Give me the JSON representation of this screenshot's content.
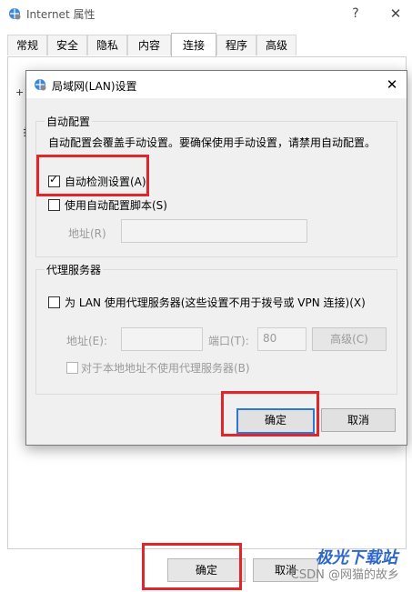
{
  "outer_window": {
    "title": "Internet 属性",
    "help_glyph": "?",
    "close_glyph": "✕",
    "tabs": [
      {
        "label": "常规"
      },
      {
        "label": "安全"
      },
      {
        "label": "隐私"
      },
      {
        "label": "内容"
      },
      {
        "label": "连接",
        "active": true
      },
      {
        "label": "程序"
      },
      {
        "label": "高级"
      }
    ],
    "ok_label": "确定",
    "cancel_label": "取消",
    "edge_marks": [
      "+",
      "扌"
    ]
  },
  "lan_dialog": {
    "title": "局域网(LAN)设置",
    "close_glyph": "✕",
    "auto_config": {
      "group_label": "自动配置",
      "description": "自动配置会覆盖手动设置。要确保使用手动设置，请禁用自动配置。",
      "auto_detect": {
        "label": "自动检测设置(A)",
        "checked": true
      },
      "use_script": {
        "label": "使用自动配置脚本(S)",
        "checked": false
      },
      "address_label": "地址(R)",
      "address_value": ""
    },
    "proxy": {
      "group_label": "代理服务器",
      "use_proxy": {
        "label": "为 LAN 使用代理服务器(这些设置不用于拨号或 VPN 连接)(X)",
        "checked": false
      },
      "address_label": "地址(E):",
      "address_value": "",
      "port_label": "端口(T):",
      "port_value": "80",
      "advanced_label": "高级(C)",
      "bypass_local": {
        "label": "对于本地地址不使用代理服务器(B)",
        "checked": false
      }
    },
    "ok_label": "确定",
    "cancel_label": "取消"
  },
  "watermark": {
    "brand": "极光下载站",
    "sub": "CSDN @网猫的故乡"
  },
  "colors": {
    "highlight": "#e0262b",
    "default_button_border": "#2b79d0",
    "dialog_bg": "#f0f0f0"
  }
}
